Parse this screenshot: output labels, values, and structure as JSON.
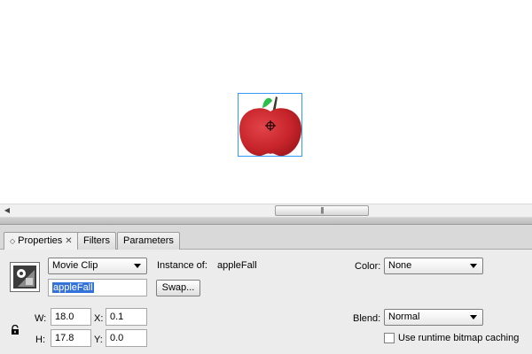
{
  "tabs": [
    {
      "label": "Properties",
      "active": true
    },
    {
      "label": "Filters",
      "active": false
    },
    {
      "label": "Parameters",
      "active": false
    }
  ],
  "properties": {
    "symbol_type": "Movie Clip",
    "instance_of_label": "Instance of:",
    "instance_of_value": "appleFall",
    "instance_name": "appleFall",
    "swap_label": "Swap...",
    "color_label": "Color:",
    "color_value": "None",
    "w_label": "W:",
    "w_value": "18.0",
    "h_label": "H:",
    "h_value": "17.8",
    "x_label": "X:",
    "x_value": "0.1",
    "y_label": "Y:",
    "y_value": "0.0",
    "blend_label": "Blend:",
    "blend_value": "Normal",
    "cache_label": "Use runtime bitmap caching",
    "cache_checked": false
  },
  "colors": {
    "selection_box": "#3399ff",
    "apple_red": "#c9252b",
    "leaf_green": "#2bbf4a"
  }
}
